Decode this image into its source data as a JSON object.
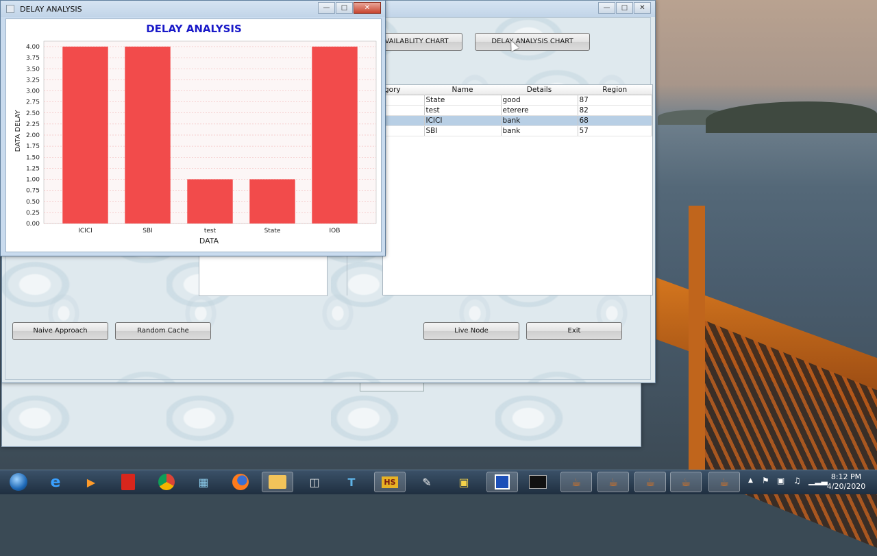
{
  "delay_window": {
    "title": "DELAY ANALYSIS"
  },
  "chart_data": {
    "type": "bar",
    "title": "DELAY ANALYSIS",
    "xlabel": "DATA",
    "ylabel": "DATA DELAY",
    "categories": [
      "ICICI",
      "SBI",
      "test",
      "State",
      "IOB"
    ],
    "values": [
      4.0,
      4.0,
      1.0,
      1.0,
      4.0
    ],
    "ylim": [
      0,
      4.0
    ],
    "yticks": [
      "0.00",
      "0.25",
      "0.50",
      "0.75",
      "1.00",
      "1.25",
      "1.50",
      "1.75",
      "2.00",
      "2.25",
      "2.50",
      "2.75",
      "3.00",
      "3.25",
      "3.50",
      "3.75",
      "4.00"
    ],
    "bar_color": "#f24b4b",
    "grid": true
  },
  "main_window": {
    "availability_btn": "VAILABLITY CHART",
    "delay_btn": "DELAY ANALYSIS CHART",
    "table": {
      "headers": [
        "gory",
        "Name",
        "Details",
        "Region"
      ],
      "rows": [
        [
          "",
          "State",
          "good",
          "87"
        ],
        [
          "",
          "test",
          "eterere",
          "82"
        ],
        [
          "",
          "ICICI",
          "bank",
          "68"
        ],
        [
          "",
          "SBI",
          "bank",
          "57"
        ]
      ]
    },
    "naive_btn": "Naive Approach",
    "random_btn": "Random Cache",
    "live_btn": "Live Node",
    "exit_btn": "Exit"
  },
  "taskbar": {
    "time": "8:12 PM",
    "date": "4/20/2020",
    "hs_label": "HS"
  }
}
